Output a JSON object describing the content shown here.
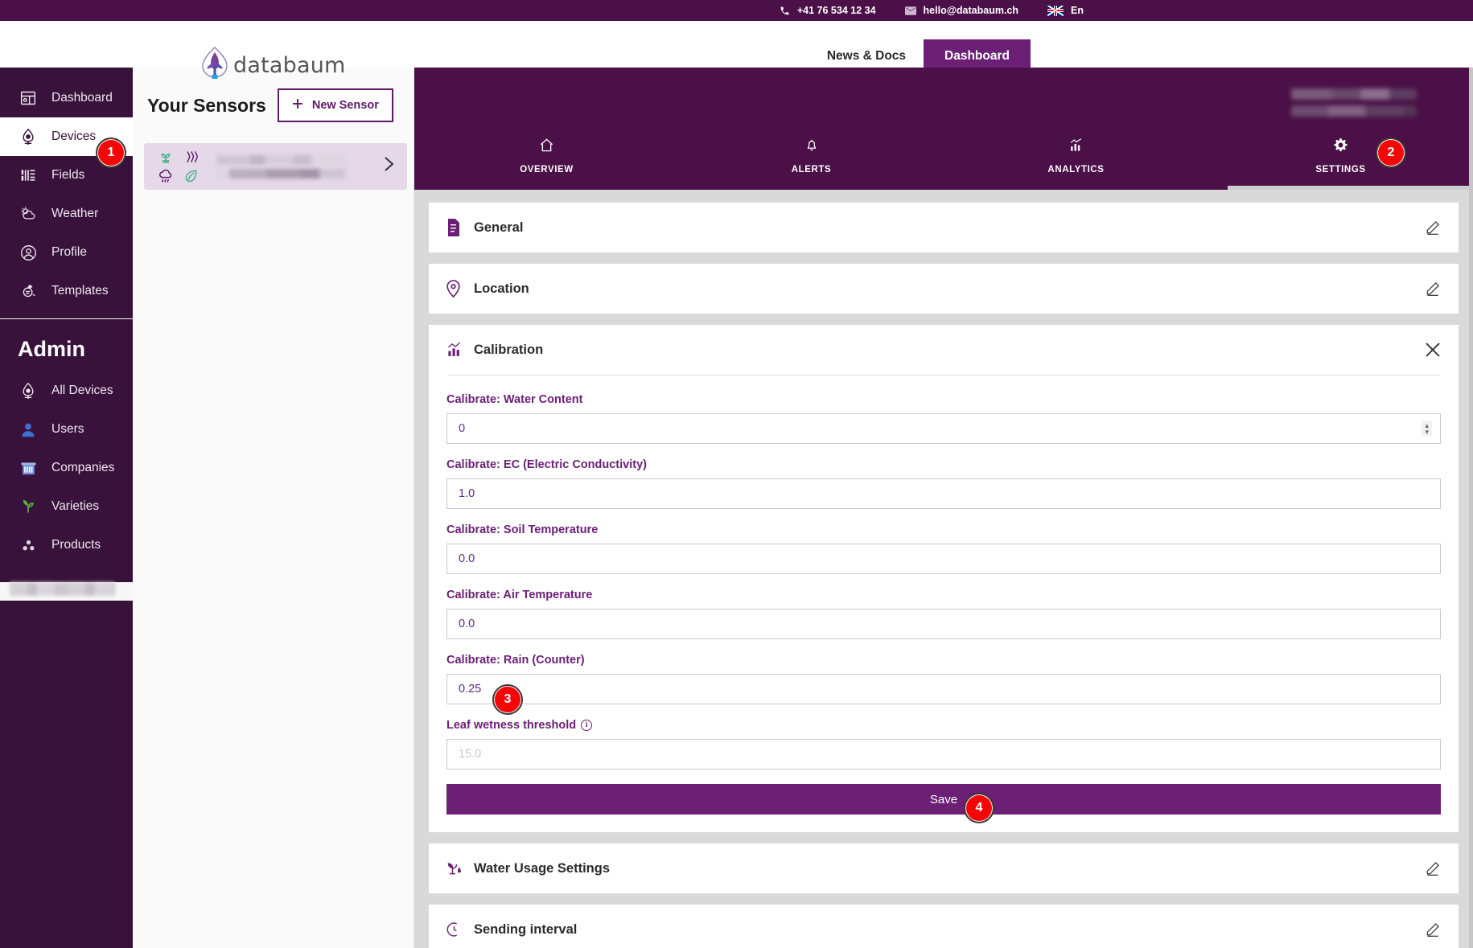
{
  "topbar": {
    "phone": "+41 76 534 12 34",
    "email": "hello@databaum.ch",
    "language": "En",
    "phone_icon": "phone-icon",
    "email_icon": "envelope-icon",
    "flag_icon": "uk-flag-icon"
  },
  "header": {
    "logo_text": "databaum",
    "news_docs": "News & Docs",
    "dashboard": "Dashboard"
  },
  "sidebar": {
    "items": [
      {
        "label": "Dashboard",
        "icon": "dashboard-icon",
        "active": false
      },
      {
        "label": "Devices",
        "icon": "device-sensor-icon",
        "active": true
      },
      {
        "label": "Fields",
        "icon": "fields-icon",
        "active": false
      },
      {
        "label": "Weather",
        "icon": "weather-icon",
        "active": false
      },
      {
        "label": "Profile",
        "icon": "profile-icon",
        "active": false
      },
      {
        "label": "Templates",
        "icon": "templates-icon",
        "active": false
      }
    ],
    "admin_title": "Admin",
    "admin_items": [
      {
        "label": "All Devices",
        "icon": "device-sensor-icon"
      },
      {
        "label": "Users",
        "icon": "user-icon"
      },
      {
        "label": "Companies",
        "icon": "building-icon"
      },
      {
        "label": "Varieties",
        "icon": "seedling-icon"
      },
      {
        "label": "Products",
        "icon": "biohazard-icon"
      }
    ]
  },
  "sensor_panel": {
    "title": "Your Sensors",
    "new_sensor_label": "New Sensor",
    "new_sensor_icon": "plus-icon",
    "sensor_item": {
      "icons": [
        "seedling-icon",
        "heat-waves-icon",
        "rain-cloud-icon",
        "leaf-icon"
      ],
      "name_redacted": true,
      "chevron": "chevron-right-icon"
    }
  },
  "device": {
    "name_redacted": true,
    "tabs": [
      {
        "label": "OVERVIEW",
        "icon": "home-icon",
        "active": false
      },
      {
        "label": "ALERTS",
        "icon": "bell-icon",
        "active": false
      },
      {
        "label": "ANALYTICS",
        "icon": "chart-icon",
        "active": false
      },
      {
        "label": "SETTINGS",
        "icon": "gear-icon",
        "active": true
      }
    ]
  },
  "settings": {
    "general": {
      "title": "General",
      "icon": "document-icon",
      "action_icon": "pencil-icon"
    },
    "location": {
      "title": "Location",
      "icon": "map-pin-icon",
      "action_icon": "pencil-icon"
    },
    "calibration": {
      "title": "Calibration",
      "icon": "bar-chart-icon",
      "action_icon": "close-icon",
      "fields": [
        {
          "label": "Calibrate: Water Content",
          "value": "0",
          "placeholder": "",
          "is_placeholder": false,
          "has_spinner": true
        },
        {
          "label": "Calibrate: EC (Electric Conductivity)",
          "value": "1.0",
          "placeholder": "",
          "is_placeholder": false,
          "has_spinner": false
        },
        {
          "label": "Calibrate: Soil Temperature",
          "value": "0.0",
          "placeholder": "",
          "is_placeholder": false,
          "has_spinner": false
        },
        {
          "label": "Calibrate: Air Temperature",
          "value": "0.0",
          "placeholder": "",
          "is_placeholder": false,
          "has_spinner": false
        },
        {
          "label": "Calibrate: Rain (Counter)",
          "value": "0.25",
          "placeholder": "",
          "is_placeholder": false,
          "has_spinner": false
        },
        {
          "label": "Leaf wetness threshold",
          "value": "15.0",
          "placeholder": "15.0",
          "is_placeholder": true,
          "has_spinner": false,
          "info_icon": "info-icon"
        }
      ],
      "save_label": "Save"
    },
    "water_usage": {
      "title": "Water Usage Settings",
      "icon": "water-plant-icon",
      "action_icon": "pencil-icon"
    },
    "sending_interval": {
      "title": "Sending interval",
      "icon": "clock-icon",
      "action_icon": "pencil-icon"
    }
  },
  "markers": [
    {
      "number": "1",
      "target": "sidebar-item-devices"
    },
    {
      "number": "2",
      "target": "tab-settings"
    },
    {
      "number": "3",
      "target": "calibrate-rain-counter-input"
    },
    {
      "number": "4",
      "target": "save-button"
    }
  ],
  "colors": {
    "topbar_purple": "#4b1047",
    "sidebar_purple": "#38123a",
    "brand_purple": "#6b2076",
    "accent_marker_red": "#f50505",
    "content_bg": "#d9d9d9",
    "sensor_item_bg": "#e5d8e8"
  }
}
